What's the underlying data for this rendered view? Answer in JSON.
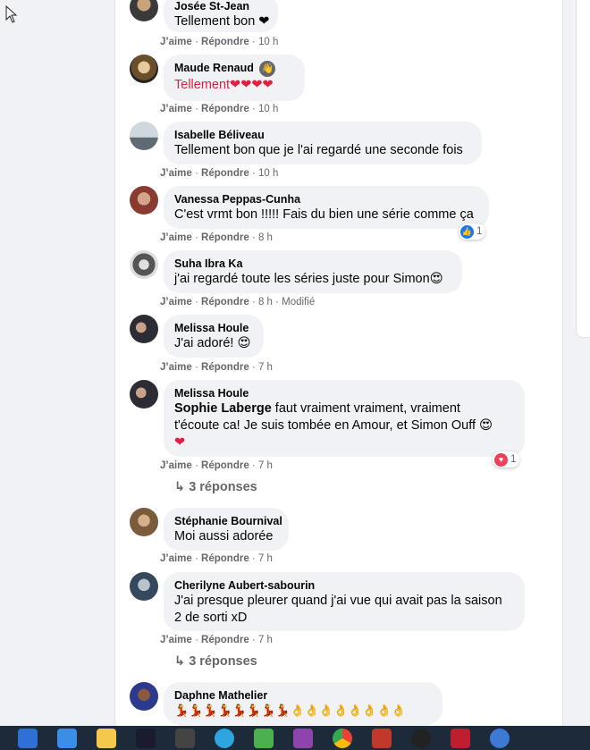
{
  "actions": {
    "like": "J’aime",
    "reply": "Répondre",
    "sep": " · "
  },
  "comments": [
    {
      "author": "Josée St-Jean",
      "text": "Tellement bon ❤",
      "time": "10 h"
    },
    {
      "author": "Maude Renaud",
      "author_badge": "👋",
      "text": "Tellement❤❤❤❤",
      "time": "10 h"
    },
    {
      "author": "Isabelle Béliveau",
      "text": "Tellement bon que je l'ai regardé une seconde fois",
      "time": "10 h"
    },
    {
      "author": "Vanessa Peppas-Cunha",
      "text": "C'est vrmt bon !!!!! Fais du bien une série comme ça",
      "time": "8 h",
      "reaction": {
        "icon": "like-icon",
        "count": "1",
        "color": "#1877f2"
      }
    },
    {
      "author": "Suha Ibra Ka",
      "text": "j'ai regardé toute les séries juste pour Simon😍",
      "time": "8 h",
      "extra": " · Modifié"
    },
    {
      "author": "Melissa Houle",
      "text": "J'ai adoré! 😍",
      "time": "7 h"
    },
    {
      "author": "Melissa Houle",
      "mention": "Sophie Laberge",
      "line1": " faut vraiment vraiment, vraiment",
      "line2": "t'écoute ca! Je suis tombée en Amour, et Simon Ouff 😍",
      "line3": "❤",
      "time": "7 h",
      "reaction": {
        "icon": "heart-icon",
        "count": "1",
        "color": "#f33e58"
      },
      "replies": "3 réponses"
    },
    {
      "author": "Stéphanie Bournival",
      "text": "Moi aussi adorée",
      "time": "7 h"
    },
    {
      "author": "Cherilyne Aubert-sabourin",
      "line1": "J'ai presque pleurer quand j'ai vue qui avait pas la saison",
      "line2": "2 de sorti xD",
      "time": "7 h",
      "replies": "3 réponses"
    },
    {
      "author": "Daphne Mathelier",
      "text": "💃💃💃💃💃💃💃💃👌👌👌👌👌👌👌👌"
    }
  ],
  "taskbar": [
    "mail-icon",
    "contacts-icon",
    "folder-icon",
    "game-icon",
    "camera-icon",
    "telegram-icon",
    "chat-icon",
    "game2-icon",
    "chrome-icon",
    "app-icon",
    "obs-icon",
    "filezilla-icon",
    "browser-icon"
  ]
}
